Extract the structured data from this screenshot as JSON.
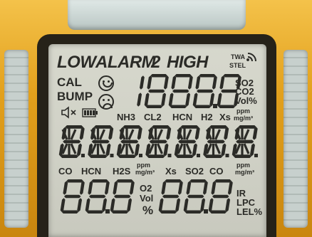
{
  "display": {
    "low_label": "LOW",
    "alarm_label": "ALARM",
    "level_2": "2",
    "high_label": "HIGH",
    "twa_label": "TWA",
    "stel_label": "STEL",
    "cal_label": "CAL",
    "bump_label": "BUMP",
    "main_digits": "1888.8",
    "unit_so2": "SO2",
    "unit_co2": "CO2",
    "unit_vol": "Vol%",
    "unit_ppm": "ppm",
    "unit_mgm3": "mg/m³",
    "gases_top": [
      "NH3",
      "CL2",
      "HCN",
      "H2",
      "Xs"
    ],
    "alnum_row": "8.8.8.8.8.8.8",
    "gases_bottom": [
      "CO",
      "HCN",
      "H2S",
      "Xs",
      "SO2",
      "CO"
    ],
    "left_digits": "88.8",
    "right_digits": "88.8",
    "o2_label": "O2",
    "vol_label": "Vol",
    "percent_label": "%",
    "ir_label": "IR",
    "lpc_label": "LPC",
    "lel_label": "LEL%"
  },
  "colors": {
    "housing": "#e2a01c",
    "lcd_background": "#d2d3c8",
    "segment": "#2b2b27"
  },
  "icons": [
    "signal-icon",
    "smiley-happy-icon",
    "smiley-sad-icon",
    "speaker-mute-icon",
    "battery-icon"
  ]
}
